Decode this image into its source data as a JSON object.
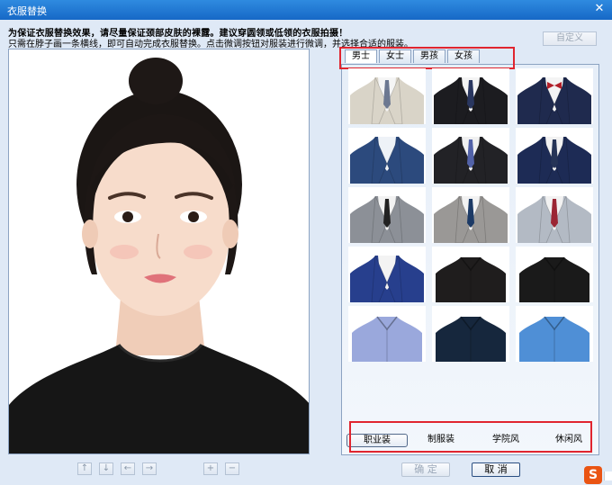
{
  "window": {
    "title": "衣服替换",
    "close_glyph": "✕"
  },
  "notice": {
    "line1": "为保证衣服替换效果，请尽量保证颈部皮肤的裸露。建议穿圆领或低领的衣服拍摄！",
    "line2": "只需在脖子画一条横线，即可自动完成衣服替换。点击微调按钮对服装进行微调，并选择合适的服装。"
  },
  "custom_button": "自定义",
  "tabs": [
    {
      "label": "男士",
      "active": true
    },
    {
      "label": "女士",
      "active": false
    },
    {
      "label": "男孩",
      "active": false
    },
    {
      "label": "女孩",
      "active": false
    }
  ],
  "clothes": [
    {
      "name": "beige-suit-grey-tie",
      "suit": "#d9d4c8",
      "shirt": "#f5f5f5",
      "tie": "#6c7891"
    },
    {
      "name": "black-suit-navy-tie",
      "suit": "#1c1c20",
      "shirt": "#f4f4f4",
      "tie": "#2a3760"
    },
    {
      "name": "navy-suit-red-bowtie",
      "suit": "#1f2a4e",
      "shirt": "#f4f4f4",
      "tie": "#b2202a",
      "bow": true
    },
    {
      "name": "blue-suit-open-collar",
      "suit": "#2c4a7d",
      "shirt": "#eef2f7",
      "tie": ""
    },
    {
      "name": "black-suit-blue-tie",
      "suit": "#222226",
      "shirt": "#f0f0f0",
      "tie": "#5262a8"
    },
    {
      "name": "navy-suit-navy-tie",
      "suit": "#1d2b55",
      "shirt": "#f2f2f2",
      "tie": "#263457"
    },
    {
      "name": "grey-suit-black-tie",
      "suit": "#8c9097",
      "shirt": "#f2f2f2",
      "tie": "#222222"
    },
    {
      "name": "grey-suit-vest",
      "suit": "#9a9896",
      "shirt": "#f2f2f2",
      "tie": "#1c3a66"
    },
    {
      "name": "light-grey-suit-striped-tie",
      "suit": "#b3bac4",
      "shirt": "#f2f2f2",
      "tie": "#9b2533"
    },
    {
      "name": "blue-check-suit",
      "suit": "#273f8d",
      "shirt": "#f3f3f3",
      "tie": ""
    },
    {
      "name": "black-shirt",
      "suit": "#1f1d1d",
      "shirt": "#1f1d1d",
      "tie": "",
      "shirt_only": true
    },
    {
      "name": "black-tee",
      "suit": "#1a1a1a",
      "shirt": "#1a1a1a",
      "tie": "",
      "shirt_only": true
    },
    {
      "name": "light-blue-shirt",
      "suit": "#9aa8dc",
      "shirt": "#9aa8dc",
      "tie": "",
      "shirt_only": true
    },
    {
      "name": "dark-navy-shirt",
      "suit": "#16273d",
      "shirt": "#16273d",
      "tie": "",
      "shirt_only": true
    },
    {
      "name": "blue-shirt",
      "suit": "#4f8fd6",
      "shirt": "#4f8fd6",
      "tie": "",
      "shirt_only": true
    }
  ],
  "styles": [
    {
      "label": "职业装",
      "active": true
    },
    {
      "label": "制服装",
      "active": false
    },
    {
      "label": "学院风",
      "active": false
    },
    {
      "label": "休闲风",
      "active": false
    }
  ],
  "adjust_tools": [
    {
      "name": "move-up-icon",
      "glyph": "↑"
    },
    {
      "name": "move-down-icon",
      "glyph": "↓"
    },
    {
      "name": "move-left-icon",
      "glyph": "←"
    },
    {
      "name": "move-right-icon",
      "glyph": "→"
    },
    {
      "name": "zoom-in-icon",
      "glyph": "+"
    },
    {
      "name": "zoom-out-icon",
      "glyph": "−"
    }
  ],
  "buttons": {
    "ok": "确 定",
    "cancel": "取 消"
  },
  "ime_logo": "S"
}
